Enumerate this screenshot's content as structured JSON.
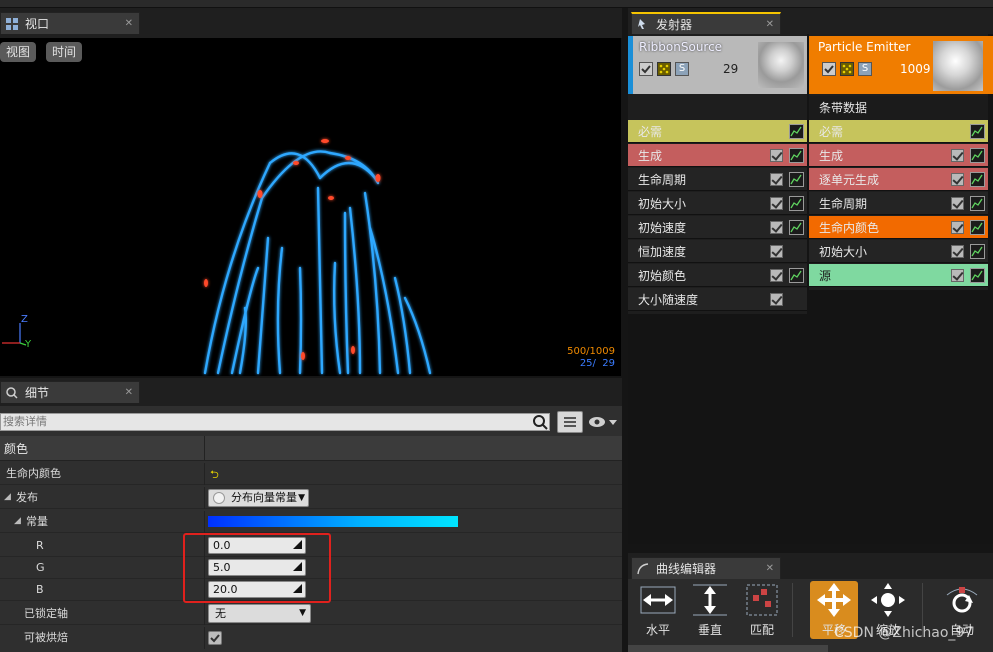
{
  "viewport": {
    "tab_label": "视口",
    "btn_view": "视图",
    "btn_time": "时间",
    "stats_particles": "500/1009",
    "stats_ribbon": "25/  29",
    "axis_z": "Z",
    "axis_y": "Y"
  },
  "details": {
    "tab_label": "细节",
    "search_placeholder": "搜索详情",
    "section": "颜色",
    "rows": {
      "life_color": "生命内颜色",
      "distribution": "发布",
      "distribution_value": "分布向量常量",
      "constant": "常量",
      "r": "R",
      "r_value": "0.0",
      "g": "G",
      "g_value": "5.0",
      "b": "B",
      "b_value": "20.0",
      "locked_axis": "已锁定轴",
      "locked_axis_value": "无",
      "bakeable": "可被烘焙"
    }
  },
  "emitters": {
    "tab_label": "发射器",
    "ribbon": {
      "name": "RibbonSource",
      "count": "29",
      "s_badge": "S",
      "modules": [
        "必需",
        "生成",
        "生命周期",
        "初始大小",
        "初始速度",
        "恒加速度",
        "初始颜色",
        "大小随速度"
      ]
    },
    "particle": {
      "name": "Particle Emitter",
      "count": "1009",
      "s_badge": "S",
      "type_label": "条带数据",
      "modules": [
        "必需",
        "生成",
        "逐单元生成",
        "生命周期",
        "生命内颜色",
        "初始大小",
        "源"
      ]
    }
  },
  "curve_editor": {
    "tab_label": "曲线编辑器",
    "buttons": [
      "水平",
      "垂直",
      "匹配",
      "平移",
      "缩放",
      "自动"
    ]
  },
  "watermark": "CSDN @Zhichao_97",
  "colors": {
    "required": "#c6c45c",
    "spawn": "#c45e5e",
    "life_color": "#f26a00",
    "source": "#7fd9a0",
    "highlight_box": "#e0211d",
    "particle_header": "#f07d00",
    "ribbon_header_stripe": "#1a8fd8"
  }
}
